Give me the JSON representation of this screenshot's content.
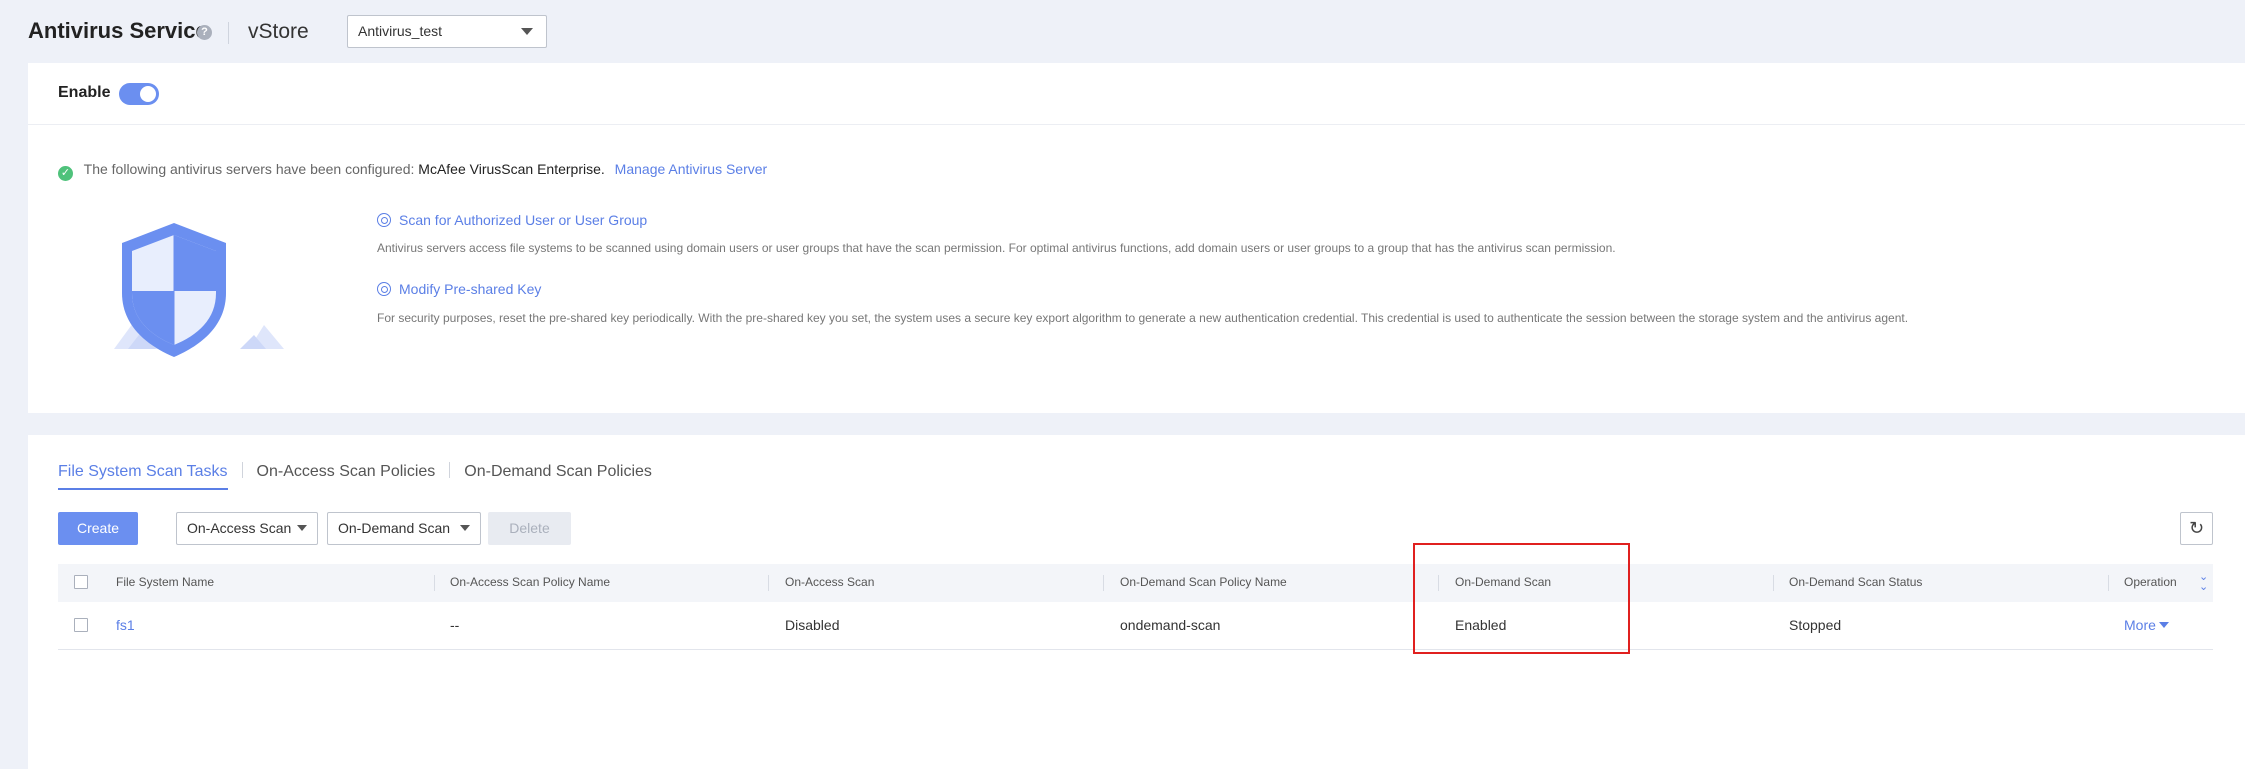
{
  "header": {
    "title": "Antivirus Service",
    "help_icon": "help-icon",
    "vstore_label": "vStore",
    "vstore_value": "Antivirus_test"
  },
  "enable_section": {
    "label": "Enable",
    "toggle_on": true
  },
  "config": {
    "info_prefix": "The following antivirus servers have been configured:",
    "server_name": "McAfee VirusScan Enterprise.",
    "manage_link": "Manage Antivirus Server",
    "features": [
      {
        "title": "Scan for Authorized User or User Group",
        "description": "Antivirus servers access file systems to be scanned using domain users or user groups that have the scan permission. For optimal antivirus functions, add domain users or user groups to a group that has the antivirus scan permission."
      },
      {
        "title": "Modify Pre-shared Key",
        "description": "For security purposes, reset the pre-shared key periodically. With the pre-shared key you set, the system uses a secure key export algorithm to generate a new authentication credential. This credential is used to authenticate the session between the storage system and the antivirus agent."
      }
    ]
  },
  "tabs": [
    {
      "label": "File System Scan Tasks",
      "active": true
    },
    {
      "label": "On-Access Scan Policies",
      "active": false
    },
    {
      "label": "On-Demand Scan Policies",
      "active": false
    }
  ],
  "toolbar": {
    "create": "Create",
    "on_access": "On-Access Scan",
    "on_demand": "On-Demand Scan",
    "delete": "Delete"
  },
  "table": {
    "columns": [
      "File System Name",
      "On-Access Scan Policy Name",
      "On-Access Scan",
      "On-Demand Scan Policy Name",
      "On-Demand Scan",
      "On-Demand Scan Status",
      "Operation"
    ],
    "rows": [
      {
        "file_system": "fs1",
        "on_access_policy": "--",
        "on_access_scan": "Disabled",
        "on_demand_policy": "ondemand-scan",
        "on_demand_scan": "Enabled",
        "status": "Stopped",
        "operation": "More"
      }
    ]
  },
  "colors": {
    "accent": "#6b8ff0",
    "link": "#5b7fe6",
    "success": "#4fc27b",
    "highlight": "#e0201f"
  }
}
